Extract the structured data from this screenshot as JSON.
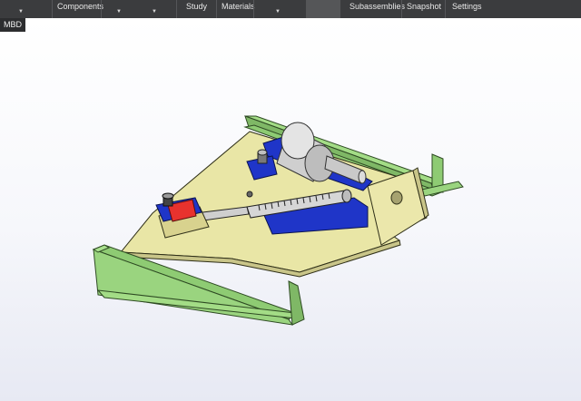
{
  "ribbon": {
    "items": [
      "Components",
      "Study",
      "Materials",
      "Subassemblies",
      "Snapshot",
      "Settings"
    ]
  },
  "tab": {
    "label": "MBD"
  },
  "colors": {
    "ribbon_bg": "#3b3c3e",
    "base_plate": "#e9e6a6",
    "rail": "#8ecb73",
    "servo": "#1f35c8",
    "motor": "#d0d0d0",
    "cap": "#e8322e"
  },
  "icons": [
    "dropdown-arrow-icon"
  ]
}
